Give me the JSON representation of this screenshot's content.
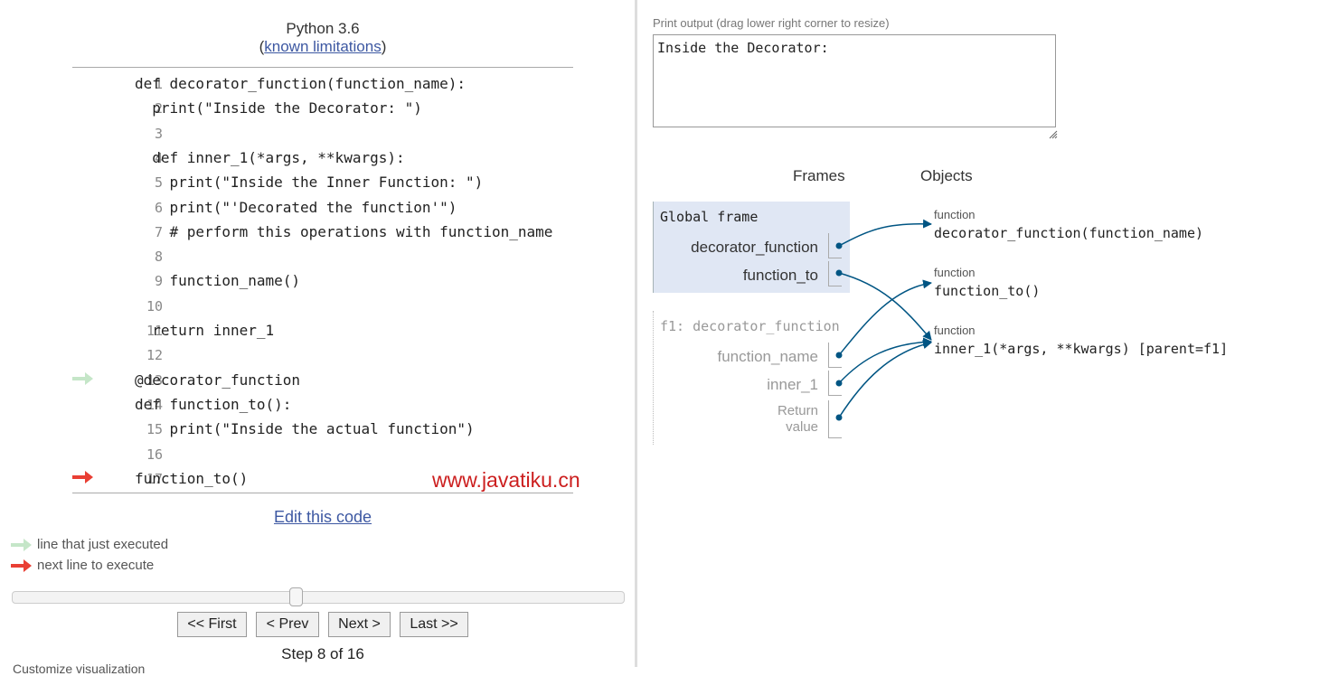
{
  "header": {
    "language": "Python 3.6",
    "limitations_open": "(",
    "limitations_link": "known limitations",
    "limitations_close": ")"
  },
  "code": {
    "lines": [
      {
        "num": "1",
        "text": "def decorator_function(function_name):",
        "marker": ""
      },
      {
        "num": "2",
        "text": "  print(\"Inside the Decorator: \")",
        "marker": ""
      },
      {
        "num": "3",
        "text": "",
        "marker": ""
      },
      {
        "num": "4",
        "text": "  def inner_1(*args, **kwargs):",
        "marker": ""
      },
      {
        "num": "5",
        "text": "    print(\"Inside the Inner Function: \")",
        "marker": ""
      },
      {
        "num": "6",
        "text": "    print(\"'Decorated the function'\")",
        "marker": ""
      },
      {
        "num": "7",
        "text": "    # perform this operations with function_name",
        "marker": ""
      },
      {
        "num": "8",
        "text": "",
        "marker": ""
      },
      {
        "num": "9",
        "text": "    function_name()",
        "marker": ""
      },
      {
        "num": "10",
        "text": "",
        "marker": ""
      },
      {
        "num": "11",
        "text": "  return inner_1",
        "marker": ""
      },
      {
        "num": "12",
        "text": "",
        "marker": ""
      },
      {
        "num": "13",
        "text": "@decorator_function",
        "marker": "executed"
      },
      {
        "num": "14",
        "text": "def function_to():",
        "marker": ""
      },
      {
        "num": "15",
        "text": "    print(\"Inside the actual function\")",
        "marker": ""
      },
      {
        "num": "16",
        "text": "",
        "marker": ""
      },
      {
        "num": "17",
        "text": "function_to()",
        "marker": "next"
      }
    ]
  },
  "watermark": "www.javatiku.cn",
  "edit_link": "Edit this code",
  "legend": {
    "executed": "line that just executed",
    "next": "next line to execute"
  },
  "colors": {
    "executed_arrow": "#c5e6c8",
    "next_arrow": "#e93f34",
    "link": "#3d58a2",
    "pointer": "#005583",
    "global_frame_bg": "#e0e7f4"
  },
  "navigation": {
    "first": "<< First",
    "prev": "< Prev",
    "next": "Next >",
    "last": "Last >>",
    "step_text": "Step 8 of 16",
    "current_step": 8,
    "total_steps": 16
  },
  "footer_cut": "Customize visualization",
  "output": {
    "label": "Print output (drag lower right corner to resize)",
    "text": "Inside the Decorator:"
  },
  "visualization": {
    "frames_header": "Frames",
    "objects_header": "Objects",
    "global_frame": {
      "title": "Global frame",
      "vars": [
        "decorator_function",
        "function_to"
      ]
    },
    "f1_frame": {
      "title": "f1: decorator_function",
      "vars": [
        "function_name",
        "inner_1",
        "Return",
        "value"
      ]
    },
    "objects": [
      {
        "type": "function",
        "signature": "decorator_function(function_name)"
      },
      {
        "type": "function",
        "signature": "function_to()"
      },
      {
        "type": "function",
        "signature": "inner_1(*args, **kwargs) [parent=f1]"
      }
    ]
  }
}
